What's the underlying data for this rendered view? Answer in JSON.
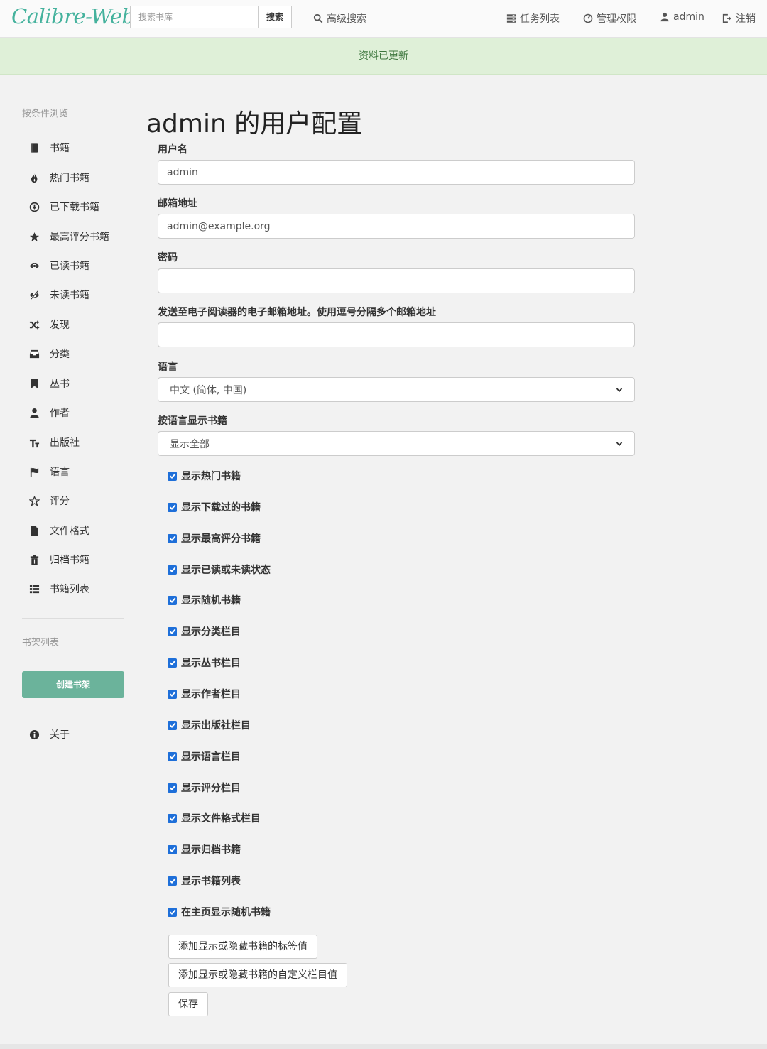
{
  "navbar": {
    "logo": "Calibre-Web",
    "search_placeholder": "搜索书库",
    "search_button": "搜索",
    "advanced_search": "高级搜索",
    "tasks": "任务列表",
    "admin_panel": "管理权限",
    "user": "admin",
    "logout": "注销"
  },
  "flash": {
    "message": "资料已更新"
  },
  "sidebar": {
    "browse_heading": "按条件浏览",
    "items": [
      {
        "label": "书籍",
        "icon": "book-icon"
      },
      {
        "label": "热门书籍",
        "icon": "fire-icon"
      },
      {
        "label": "已下载书籍",
        "icon": "download-icon"
      },
      {
        "label": "最高评分书籍",
        "icon": "star-icon"
      },
      {
        "label": "已读书籍",
        "icon": "eye-open-icon"
      },
      {
        "label": "未读书籍",
        "icon": "eye-close-icon"
      },
      {
        "label": "发现",
        "icon": "random-icon"
      },
      {
        "label": "分类",
        "icon": "inbox-icon"
      },
      {
        "label": "丛书",
        "icon": "bookmark-icon"
      },
      {
        "label": "作者",
        "icon": "user-icon"
      },
      {
        "label": "出版社",
        "icon": "text-size-icon"
      },
      {
        "label": "语言",
        "icon": "flag-icon"
      },
      {
        "label": "评分",
        "icon": "star-empty-icon"
      },
      {
        "label": "文件格式",
        "icon": "file-icon"
      },
      {
        "label": "归档书籍",
        "icon": "trash-icon"
      },
      {
        "label": "书籍列表",
        "icon": "th-list-icon"
      }
    ],
    "shelves_heading": "书架列表",
    "create_shelf": "创建书架",
    "about": "关于"
  },
  "main": {
    "title": "admin 的用户配置",
    "username_label": "用户名",
    "username_value": "admin",
    "email_label": "邮箱地址",
    "email_value": "admin@example.org",
    "password_label": "密码",
    "password_value": "",
    "kindle_label": "发送至电子阅读器的电子邮箱地址。使用逗号分隔多个邮箱地址",
    "kindle_value": "",
    "locale_label": "语言",
    "locale_value": "中文 (简体, 中国)",
    "book_lang_label": "按语言显示书籍",
    "book_lang_value": "显示全部",
    "checkboxes": [
      {
        "label": "显示热门书籍",
        "checked": true
      },
      {
        "label": "显示下载过的书籍",
        "checked": true
      },
      {
        "label": "显示最高评分书籍",
        "checked": true
      },
      {
        "label": "显示已读或未读状态",
        "checked": true
      },
      {
        "label": "显示随机书籍",
        "checked": true
      },
      {
        "label": "显示分类栏目",
        "checked": true
      },
      {
        "label": "显示丛书栏目",
        "checked": true
      },
      {
        "label": "显示作者栏目",
        "checked": true
      },
      {
        "label": "显示出版社栏目",
        "checked": true
      },
      {
        "label": "显示语言栏目",
        "checked": true
      },
      {
        "label": "显示评分栏目",
        "checked": true
      },
      {
        "label": "显示文件格式栏目",
        "checked": true
      },
      {
        "label": "显示归档书籍",
        "checked": true
      },
      {
        "label": "显示书籍列表",
        "checked": true
      },
      {
        "label": "在主页显示随机书籍",
        "checked": true
      }
    ],
    "tags_button": "添加显示或隐藏书籍的标签值",
    "custom_column_button": "添加显示或隐藏书籍的自定义栏目值",
    "save_button": "保存"
  },
  "colors": {
    "brand": "#45b29d",
    "flash_bg": "#dff0d8",
    "flash_text": "#3c763d",
    "create_btn": "#6bb39b",
    "checkbox": "#1e6fd9"
  }
}
